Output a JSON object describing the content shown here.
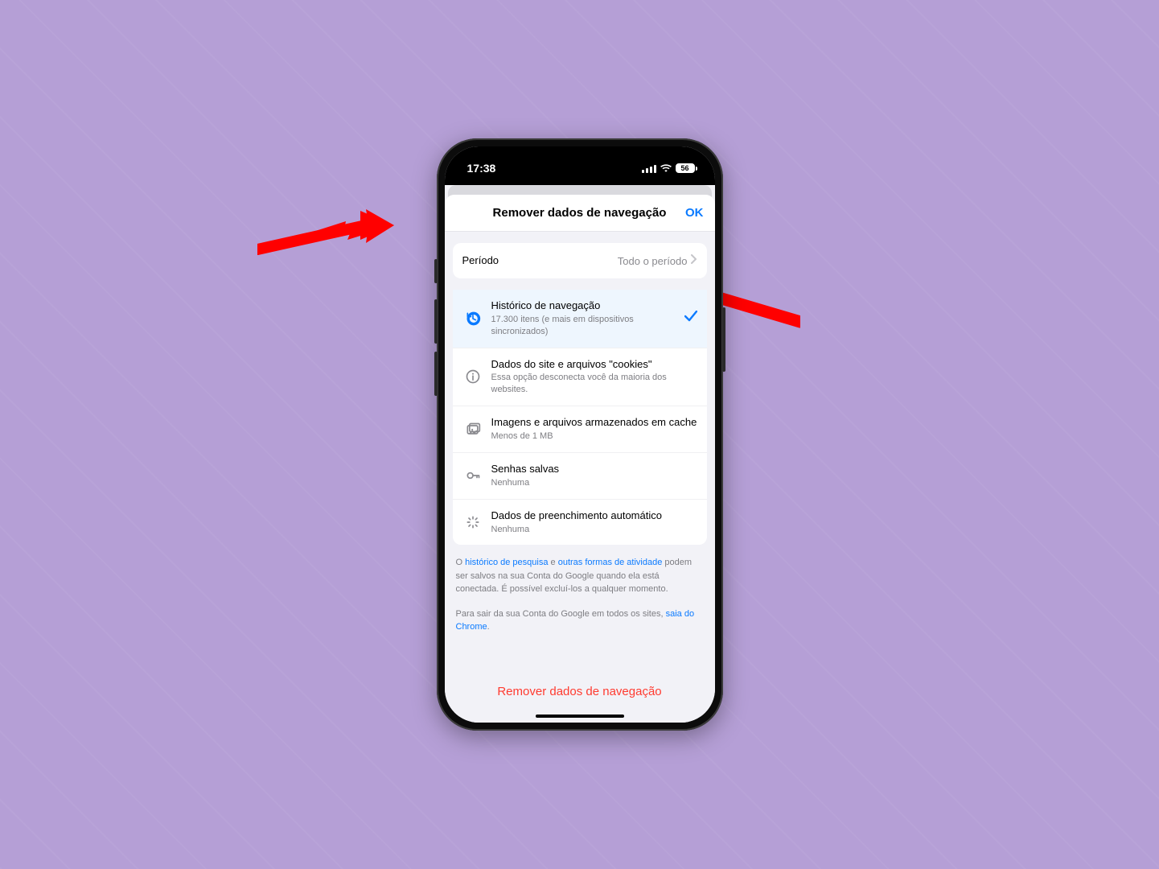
{
  "status": {
    "time": "17:38",
    "battery": "56"
  },
  "sheet": {
    "title": "Remover dados de navegação",
    "ok": "OK"
  },
  "period": {
    "label": "Período",
    "value": "Todo o período"
  },
  "items": {
    "history": {
      "title": "Histórico de navegação",
      "sub": "17.300 itens (e mais em dispositivos sincronizados)"
    },
    "cookies": {
      "title": "Dados do site e arquivos \"cookies\"",
      "sub": "Essa opção desconecta você da maioria dos websites."
    },
    "cache": {
      "title": "Imagens e arquivos armazenados em cache",
      "sub": "Menos de 1 MB"
    },
    "passwords": {
      "title": "Senhas salvas",
      "sub": "Nenhuma"
    },
    "autofill": {
      "title": "Dados de preenchimento automático",
      "sub": "Nenhuma"
    }
  },
  "footer": {
    "p1_pre": "O ",
    "p1_link1": "histórico de pesquisa",
    "p1_mid": " e ",
    "p1_link2": "outras formas de atividade",
    "p1_post": " podem ser salvos na sua Conta do Google quando ela está conectada. É possível excluí-los a qualquer momento.",
    "p2_pre": "Para sair da sua Conta do Google em todos os sites, ",
    "p2_link": "saia do Chrome",
    "p2_post": "."
  },
  "clear_button": "Remover dados de navegação"
}
